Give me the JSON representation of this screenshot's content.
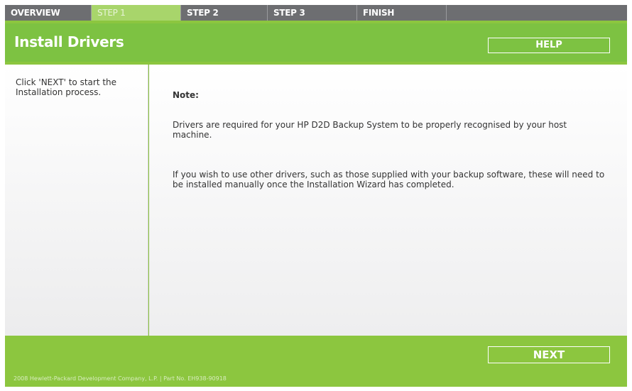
{
  "tabs": [
    {
      "label": "OVERVIEW",
      "active": false
    },
    {
      "label": "STEP 1",
      "active": true
    },
    {
      "label": "STEP 2",
      "active": false
    },
    {
      "label": "STEP 3",
      "active": false
    },
    {
      "label": "FINISH",
      "active": false
    }
  ],
  "header": {
    "title": "Install Drivers",
    "help_label": "HELP"
  },
  "sidebar": {
    "text": "Click 'NEXT' to start the Installation process."
  },
  "main": {
    "note_title": "Note:",
    "paragraph_1": "Drivers are required for your HP D2D Backup System to be properly recognised by your host machine.",
    "paragraph_2": "If you wish to use other drivers, such as those supplied with your backup software, these will need to be installed manually once the Installation Wizard has completed."
  },
  "footer": {
    "next_label": "NEXT",
    "copyright": "2008 Hewlett-Packard Development Company, L.P.  |  Part No. EH938-90918"
  },
  "colors": {
    "brand_green": "#8cc63f",
    "header_green": "#7dc242",
    "tab_gray": "#6d6e71",
    "active_tab": "#a8d56b"
  }
}
